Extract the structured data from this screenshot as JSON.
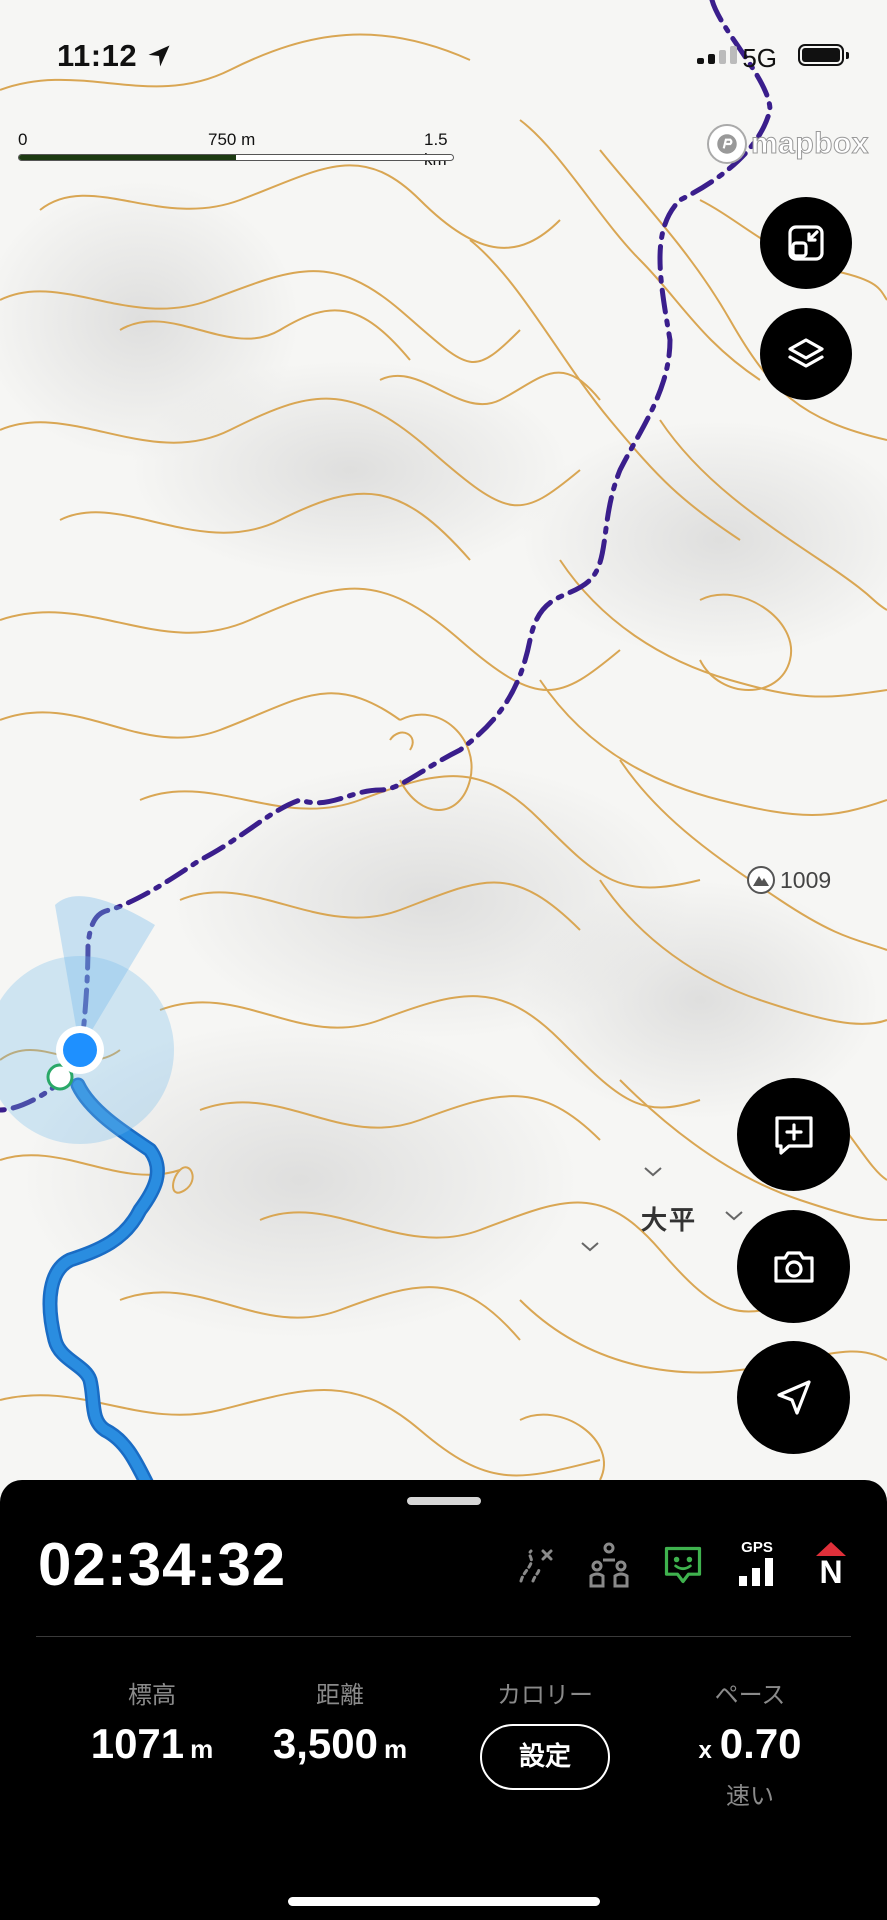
{
  "status_bar": {
    "time": "11:12",
    "network": "5G"
  },
  "scale": {
    "start": "0",
    "mid": "750 m",
    "end": "1.5 km"
  },
  "attribution": "mapbox",
  "map_labels": {
    "peak_elevation": "1009",
    "place_name": "大平"
  },
  "map_buttons": [
    {
      "name": "fit-route-button",
      "icon": "minimize-icon"
    },
    {
      "name": "layers-button",
      "icon": "layers-icon"
    },
    {
      "name": "add-note-button",
      "icon": "note-plus-icon"
    },
    {
      "name": "camera-button",
      "icon": "camera-icon"
    },
    {
      "name": "locate-button",
      "icon": "navigation-arrow-icon"
    }
  ],
  "panel": {
    "elapsed": "02:34:32",
    "indicators": [
      {
        "name": "route-off",
        "icon": "route-off-icon"
      },
      {
        "name": "companions",
        "icon": "people-icon"
      },
      {
        "name": "support",
        "icon": "support-chat-icon"
      },
      {
        "name": "gps",
        "label": "GPS",
        "icon": "gps-signal-icon"
      },
      {
        "name": "compass",
        "label": "N",
        "icon": "compass-icon"
      }
    ],
    "stats": {
      "elevation": {
        "label": "標高",
        "value": "1071",
        "unit": "m"
      },
      "distance": {
        "label": "距離",
        "value": "3,500",
        "unit": "m"
      },
      "calories": {
        "label": "カロリー",
        "button": "設定"
      },
      "pace": {
        "label": "ペース",
        "prefix": "x",
        "value": "0.70",
        "note": "速い"
      }
    }
  },
  "colors": {
    "contour": "#d9a653",
    "planned_route": "#3a1e8c",
    "track": "#2a8de0",
    "location": "#1e90ff",
    "panel_bg": "#000000"
  }
}
